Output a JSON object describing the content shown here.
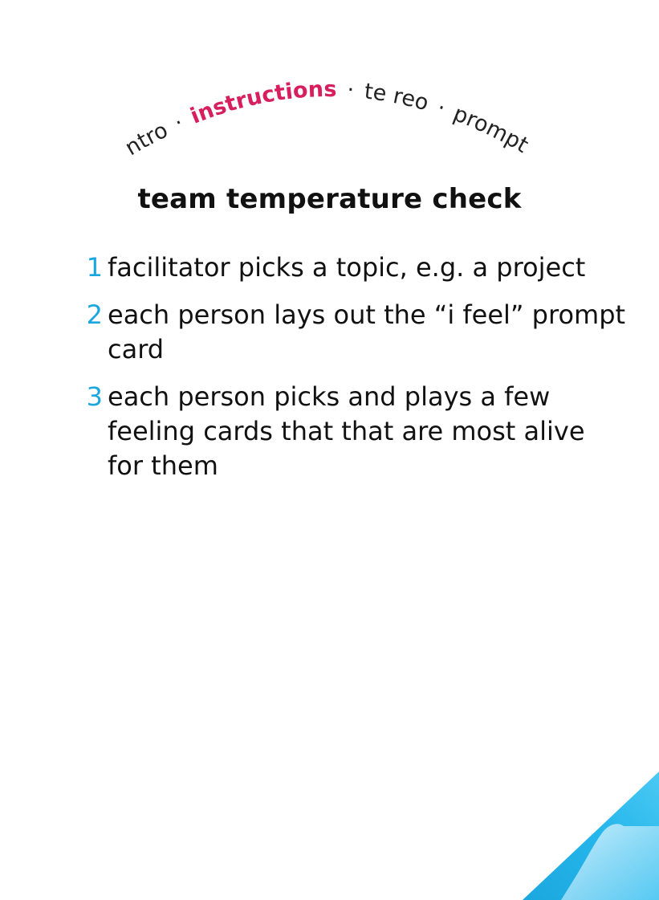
{
  "nav": {
    "items": [
      {
        "label": "intro",
        "active": false
      },
      {
        "label": "instructions",
        "active": true
      },
      {
        "label": "te reo",
        "active": false
      },
      {
        "label": "prompts",
        "active": false
      }
    ],
    "separator": "·",
    "active_color": "#d81f5d",
    "inactive_color": "#222222"
  },
  "title": "team temperature check",
  "steps": [
    {
      "number": "1",
      "text": "facilitator picks a topic, e.g. a project"
    },
    {
      "number": "2",
      "text": "each person lays out the “i feel” prompt card"
    },
    {
      "number": "3",
      "text": "each person picks and plays a few feeling cards that that are most alive for them"
    }
  ],
  "colors": {
    "step_number": "#1aa7df",
    "corner_blue": "#1fb6ea"
  }
}
